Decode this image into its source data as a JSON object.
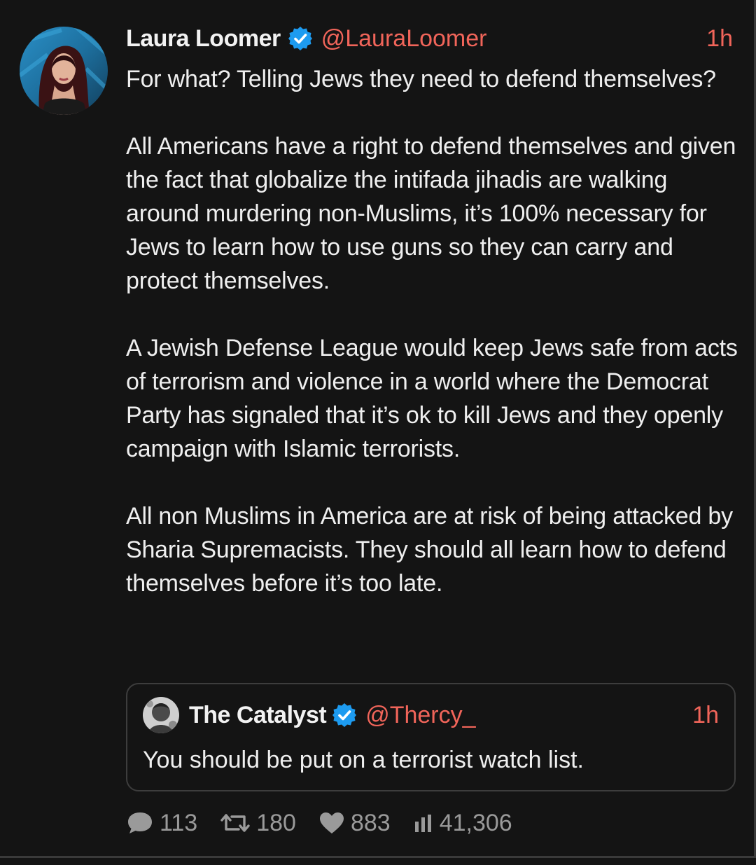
{
  "tweet": {
    "author_name": "Laura Loomer",
    "author_handle": "@LauraLoomer",
    "verified": true,
    "time": "1h",
    "paragraphs": [
      "For what? Telling Jews they need to defend themselves?",
      "All Americans have a right to defend themselves and given the fact that globalize the intifada jihadis are walking around murdering non-Muslims, it’s 100% necessary for Jews to learn how to use guns so they can carry and protect themselves.",
      "A Jewish Defense League would keep Jews safe from acts of terrorism and violence in a world where the Democrat Party has signaled that it’s ok to kill Jews and they openly campaign with Islamic terrorists.",
      "All non Muslims in America are at risk of being attacked by Sharia Supremacists. They should all learn how to defend themselves before it’s too late."
    ]
  },
  "quoted_tweet": {
    "author_name": "The Catalyst",
    "author_handle": "@Thercy_",
    "verified": true,
    "time": "1h",
    "text": "You should be put on a terrorist watch list."
  },
  "stats": {
    "replies": "113",
    "retweets": "180",
    "likes": "883",
    "views": "41,306"
  },
  "icons": {
    "reply": "speech-bubble-icon",
    "retweet": "retweet-icon",
    "like": "heart-icon",
    "views": "bar-chart-icon",
    "verified": "verified-badge-icon"
  },
  "colors": {
    "background": "#141414",
    "accent_handle": "#f1655a",
    "verified_blue": "#1d9bf0",
    "text": "#efefef",
    "muted": "#9a9a9a"
  }
}
